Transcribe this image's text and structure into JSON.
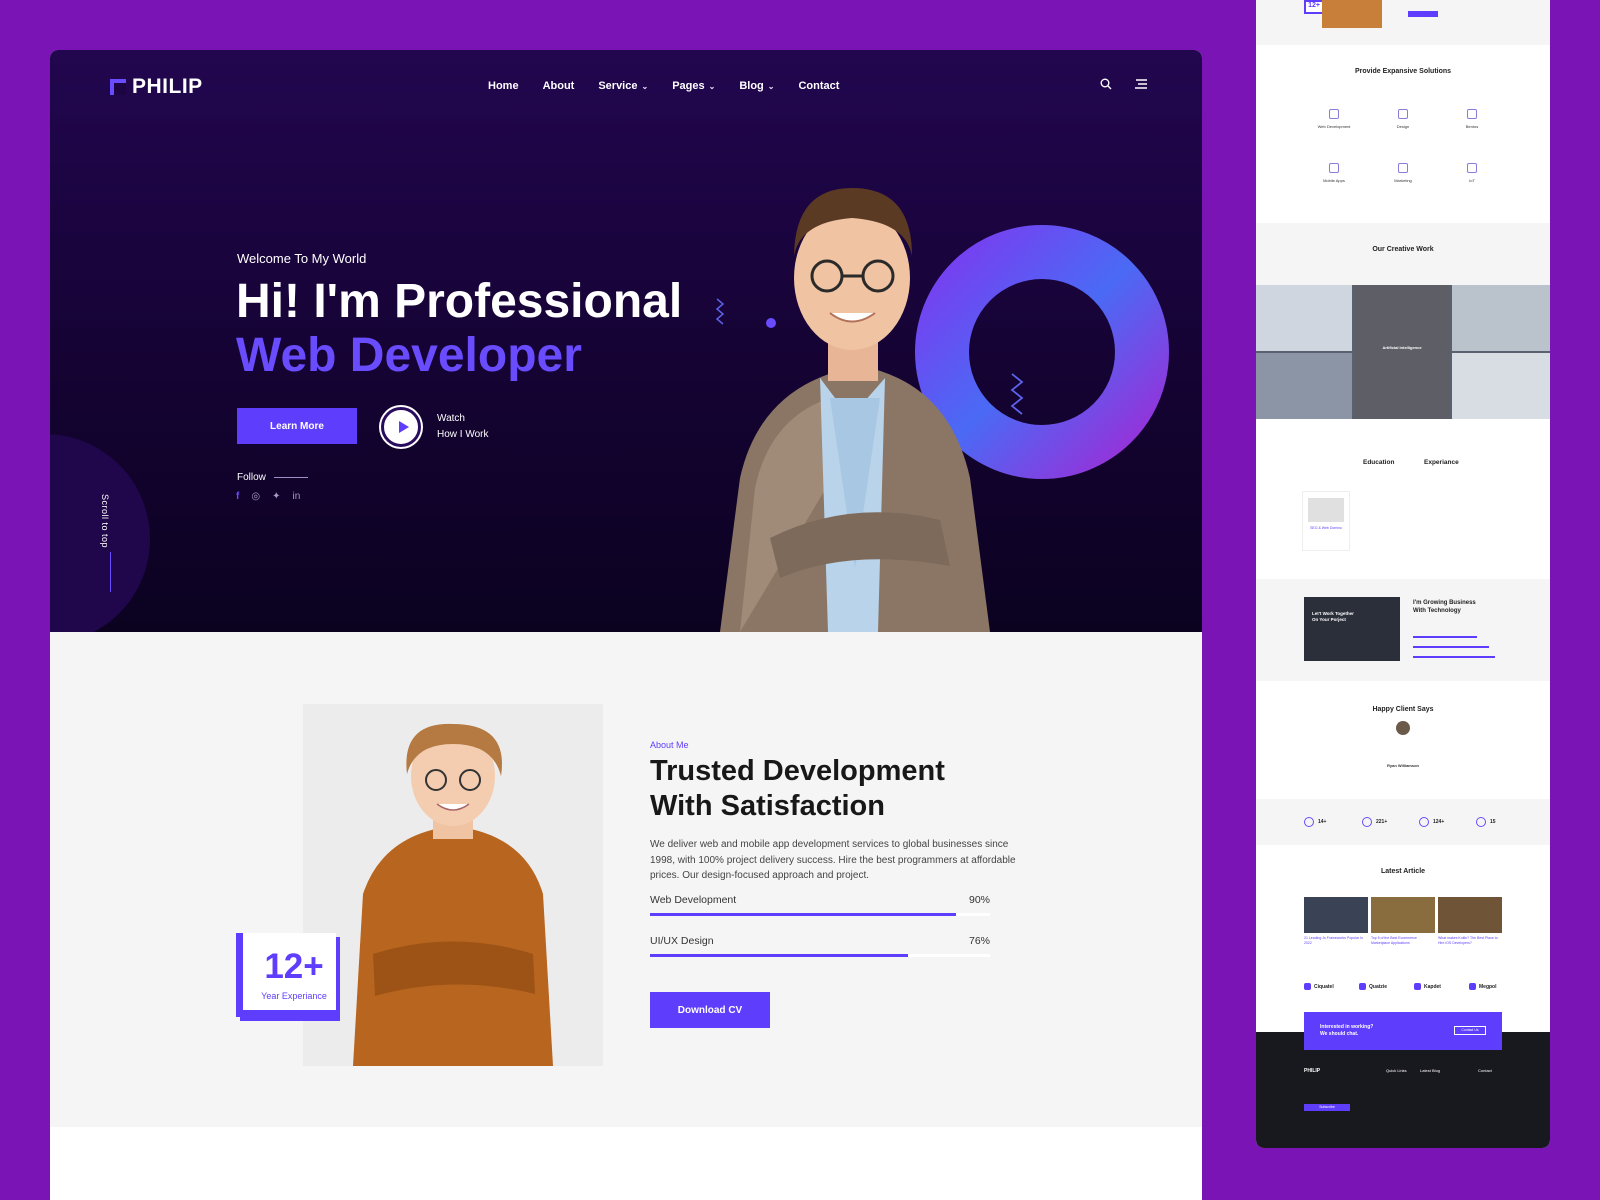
{
  "brand": {
    "name": "PHILIP"
  },
  "nav": {
    "items": [
      {
        "label": "Home",
        "dropdown": false
      },
      {
        "label": "About",
        "dropdown": false
      },
      {
        "label": "Service",
        "dropdown": true
      },
      {
        "label": "Pages",
        "dropdown": true
      },
      {
        "label": "Blog",
        "dropdown": true
      },
      {
        "label": "Contact",
        "dropdown": false
      }
    ],
    "icons": [
      "search-icon",
      "menu-icon"
    ]
  },
  "hero": {
    "welcome": "Welcome To My World",
    "title_line1": "Hi! I'm Professional",
    "title_line2": "Web Developer",
    "cta_label": "Learn More",
    "watch_line1": "Watch",
    "watch_line2": "How I Work",
    "follow_label": "Follow",
    "scroll_label": "Scroll to top",
    "socials": [
      "facebook-icon",
      "dribbble-icon",
      "twitter-icon",
      "linkedin-icon"
    ]
  },
  "about": {
    "tag": "About Me",
    "title_line1": "Trusted Development",
    "title_line2": "With Satisfaction",
    "description": "We deliver web and mobile app development services to global businesses since 1998, with 100% project delivery success. Hire the best programmers at affordable prices. Our design-focused approach and project.",
    "experience_value": "12+",
    "experience_label": "Year Experiance",
    "skills": [
      {
        "name": "Web Development",
        "percent_label": "90%",
        "percent": 90
      },
      {
        "name": "UI/UX Design",
        "percent_label": "76%",
        "percent": 76
      }
    ],
    "cv_label": "Download CV"
  },
  "side": {
    "top_value": "12+",
    "solutions_title": "Provide Expansive Solutions",
    "services": [
      {
        "name": "Web Development"
      },
      {
        "name": "Design"
      },
      {
        "name": "Bentos"
      },
      {
        "name": "Mobile Apps"
      },
      {
        "name": "Marketing"
      },
      {
        "name": "IoT"
      }
    ],
    "work_title": "Our Creative Work",
    "work_caption": "Artificial Intelligence",
    "education_tab": "Education",
    "experience_tab": "Experiance",
    "edu_card_title": "SEO & Web Domino",
    "cta_title_line1": "Let't Work Together",
    "cta_title_line2": "On Your Porject",
    "growing_title_line1": "I'm Growing Business",
    "growing_title_line2": "With Technology",
    "client_title": "Happy Client Says",
    "client_name": "Ryan Williamson",
    "stats": [
      {
        "value": "14+"
      },
      {
        "value": "221+"
      },
      {
        "value": "124+"
      },
      {
        "value": "15"
      }
    ],
    "article_title": "Latest Article",
    "articles": [
      {
        "title": "21 Leading Js Frameworks Popular In 2022"
      },
      {
        "title": "Top 5 of the Best Ecommerce Marketplace Applications"
      },
      {
        "title": "What makes Kotlin? The Best Place to Hire iOS Developers?"
      }
    ],
    "brands": [
      "Ciquatel",
      "Quatzie",
      "Kapdet",
      "Megpol"
    ],
    "banner_line1": "Interested in working?",
    "banner_line2": "We should chat.",
    "banner_button": "Contact Us",
    "footer_brand": "PHILIP",
    "footer_subscribe": "Subscribe",
    "footer_cols": [
      "Quick Links",
      "Latest Blog",
      "Contact"
    ]
  },
  "colors": {
    "accent": "#5f3dfc",
    "page_bg": "#7b14b4",
    "hero_bg": "#150333"
  }
}
